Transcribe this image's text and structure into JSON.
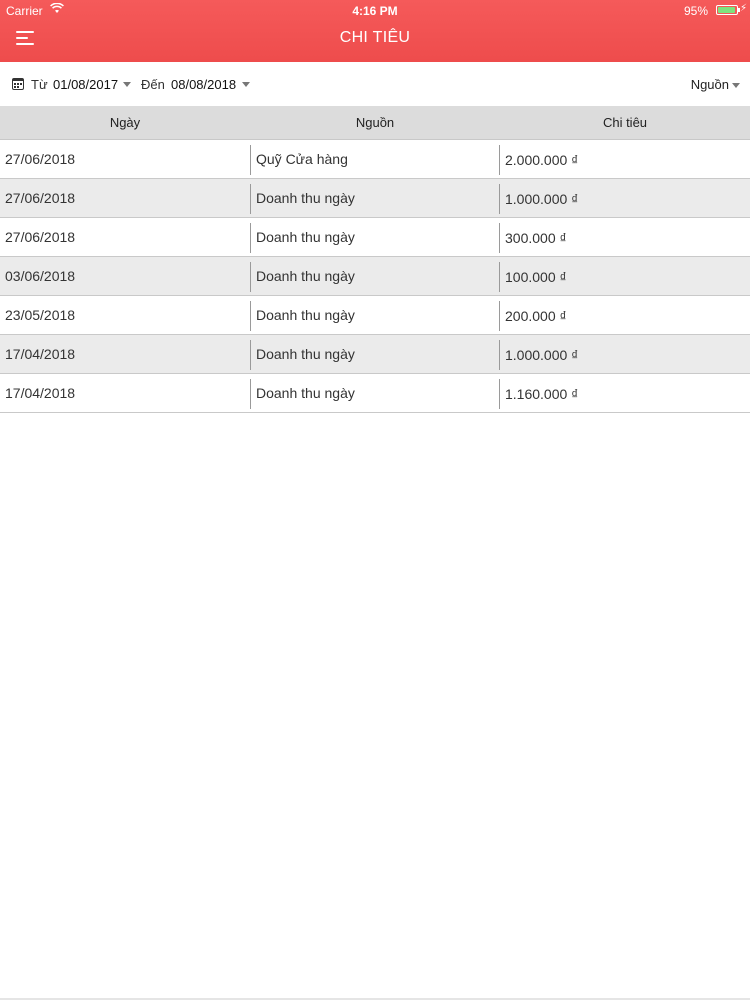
{
  "status_bar": {
    "carrier": "Carrier",
    "time": "4:16 PM",
    "battery": "95%"
  },
  "header": {
    "title": "CHI TIÊU"
  },
  "filter": {
    "from_label": "Từ",
    "from_date": "01/08/2017",
    "to_label": "Đến",
    "to_date": "08/08/2018",
    "source_label": "Nguồn"
  },
  "table": {
    "columns": [
      "Ngày",
      "Nguồn",
      "Chi tiêu"
    ],
    "rows": [
      {
        "date": "27/06/2018",
        "source": "Quỹ Cửa hàng",
        "amount": "2.000.000 ₫"
      },
      {
        "date": "27/06/2018",
        "source": "Doanh thu ngày",
        "amount": "1.000.000 ₫"
      },
      {
        "date": "27/06/2018",
        "source": "Doanh thu ngày",
        "amount": "300.000 ₫"
      },
      {
        "date": "03/06/2018",
        "source": "Doanh thu ngày",
        "amount": "100.000 ₫"
      },
      {
        "date": "23/05/2018",
        "source": "Doanh thu ngày",
        "amount": "200.000 ₫"
      },
      {
        "date": "17/04/2018",
        "source": "Doanh thu ngày",
        "amount": "1.000.000 ₫"
      },
      {
        "date": "17/04/2018",
        "source": "Doanh thu ngày",
        "amount": "1.160.000 ₫"
      }
    ]
  },
  "colors": {
    "header_bg": "#f24f4f",
    "table_header_bg": "#dcdcdc",
    "alt_row_bg": "#ebebeb"
  }
}
